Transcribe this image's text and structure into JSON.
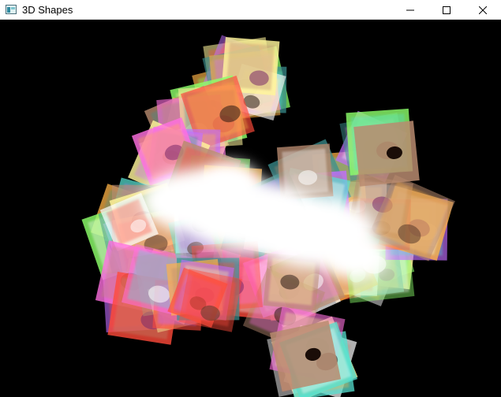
{
  "window": {
    "title": "3D Shapes",
    "icon": "app-window-icon",
    "controls": [
      "minimize-icon",
      "maximize-icon",
      "close-icon"
    ]
  },
  "scene": {
    "background": "#000000",
    "shape_count": 120,
    "texture_colors": [
      "#ffffff",
      "#fff59a",
      "#ff6fe0",
      "#8cff6a",
      "#ff4a3a",
      "#c26dff",
      "#55e0d0",
      "#ffb347",
      "#b98b70",
      "#3a8f8f"
    ]
  }
}
